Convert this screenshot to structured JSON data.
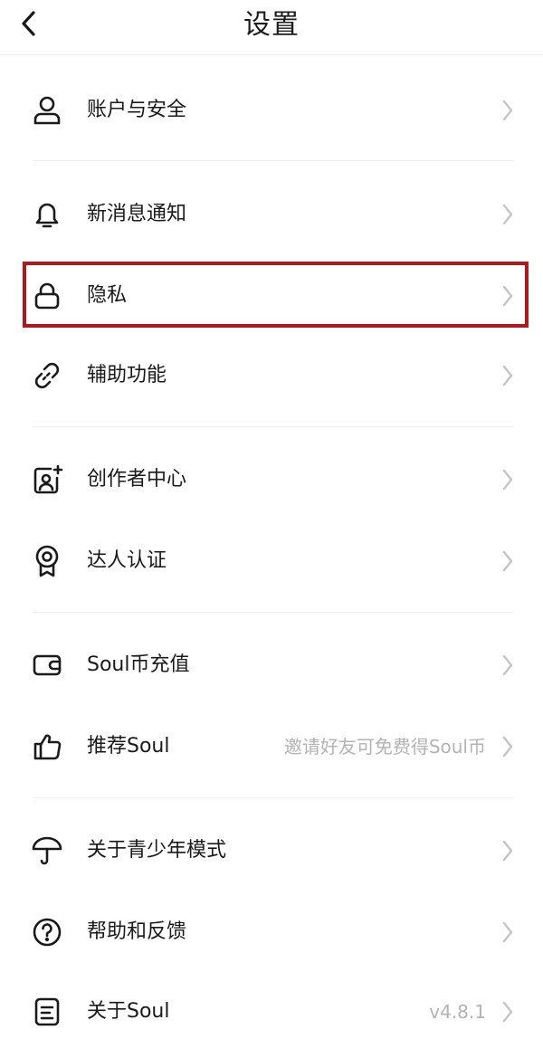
{
  "header": {
    "title": "设置",
    "back_icon": "chevron-left-icon"
  },
  "menu": [
    {
      "label": "账户与安全",
      "icon": "user-icon"
    },
    {
      "label": "新消息通知",
      "icon": "bell-icon"
    },
    {
      "label": "隐私",
      "icon": "lock-icon",
      "highlighted": true
    },
    {
      "label": "辅助功能",
      "icon": "link-icon"
    },
    {
      "label": "创作者中心",
      "icon": "creator-icon"
    },
    {
      "label": "达人认证",
      "icon": "badge-icon"
    },
    {
      "label": "Soul币充值",
      "icon": "wallet-icon"
    },
    {
      "label": "推荐Soul",
      "hint": "邀请好友可免费得Soul币",
      "icon": "thumbs-up-icon"
    },
    {
      "label": "关于青少年模式",
      "icon": "umbrella-icon"
    },
    {
      "label": "帮助和反馈",
      "icon": "help-circle-icon"
    },
    {
      "label": "关于Soul",
      "hint": "v4.8.1",
      "icon": "document-icon"
    }
  ],
  "colors": {
    "highlight_border": "#b3171c",
    "hint_text": "#b3b3b3",
    "chevron": "#c4c4c4"
  }
}
